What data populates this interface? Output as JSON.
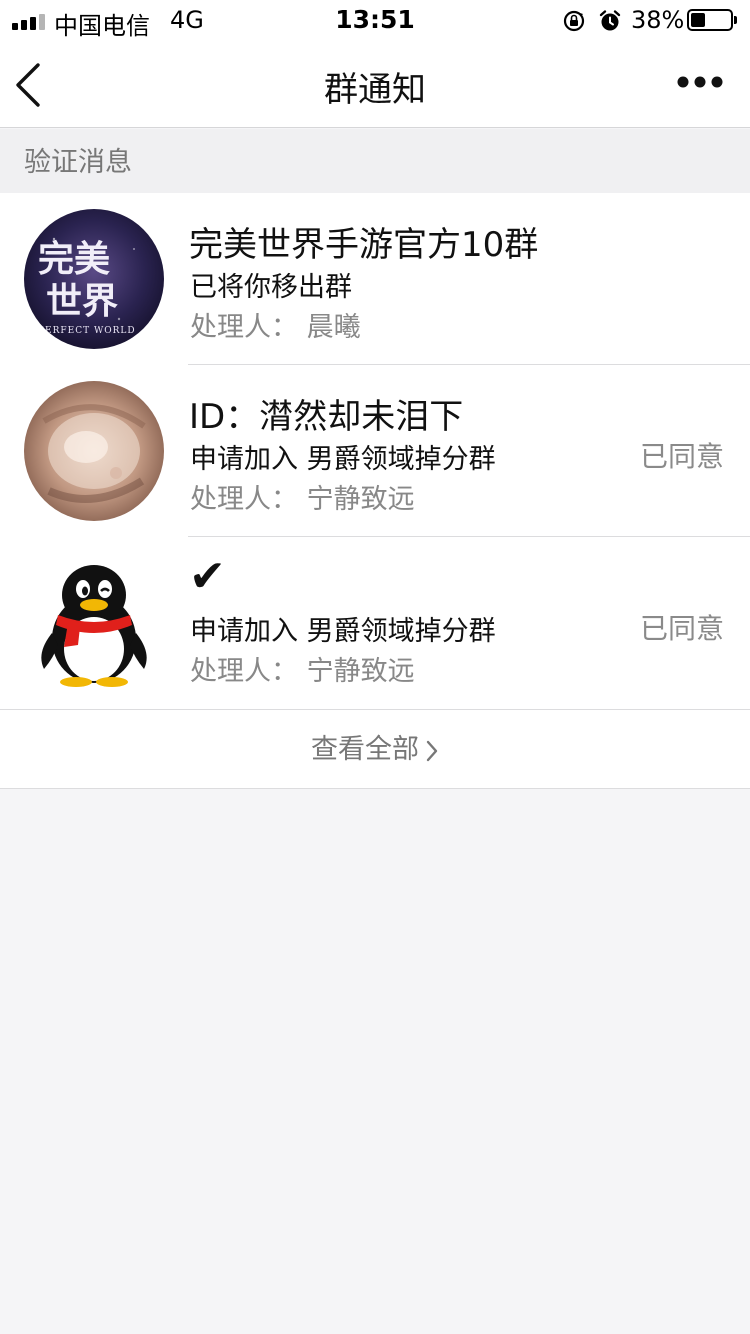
{
  "status_bar": {
    "carrier": "中国电信",
    "network": "4G",
    "time": "13:51",
    "battery_percent": "38%",
    "battery_level": 0.38
  },
  "nav": {
    "title": "群通知"
  },
  "section": {
    "title": "验证消息"
  },
  "items": [
    {
      "title": "完美世界手游官方10群",
      "line2": "已将你移出群",
      "line3": "处理人： 晨曦",
      "status": "",
      "avatar_icon": "perfect-world-logo"
    },
    {
      "title": "ID：潸然却未泪下",
      "line2": "申请加入 男爵领域掉分群",
      "line3": "处理人： 宁静致远",
      "status": "已同意",
      "avatar_icon": "photo-avatar"
    },
    {
      "title": "✔",
      "line2": "申请加入 男爵领域掉分群",
      "line3": "处理人： 宁静致远",
      "status": "已同意",
      "avatar_icon": "qq-penguin-avatar"
    }
  ],
  "view_all": {
    "label": "查看全部"
  },
  "logo_text": {
    "perfect_world_cn": "完美世界",
    "perfect_world_en": "PERFECT WORLD"
  }
}
